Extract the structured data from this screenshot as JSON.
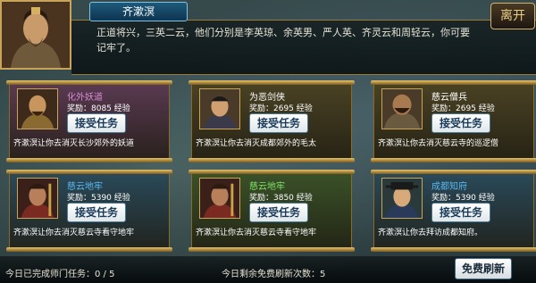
{
  "npc": {
    "name": "齐漱溟",
    "dialog": "正道将兴，三英二云，他们分别是李英琼、余英男、严人英、齐灵云和周轻云，你可要记牢了。",
    "leave_label": "离开"
  },
  "tasks": [
    {
      "title": "化外妖道",
      "title_color": "#d58ad4",
      "reward": "奖励：8085 经验",
      "accept_label": "接受任务",
      "desc": "齐漱溟让你去消灭长沙郊外的妖道",
      "bg_color": "#5a3a52",
      "icon": "bald-monk-portrait"
    },
    {
      "title": "为恶剑侠",
      "title_color": "#ffffff",
      "reward": "奖励：2695 经验",
      "accept_label": "接受任务",
      "desc": "齐漱溟让你去消灭成都郊外的毛太",
      "bg_color": "#4a4224",
      "icon": "swordsman-portrait"
    },
    {
      "title": "慈云僧兵",
      "title_color": "#ffffff",
      "reward": "奖励：2695 经验",
      "accept_label": "接受任务",
      "desc": "齐漱溟让你去消灭慈云寺的巡逻僧",
      "bg_color": "#4a4224",
      "icon": "monk-soldier-portrait"
    },
    {
      "title": "慈云地牢",
      "title_color": "#5ab7f0",
      "reward": "奖励：5390 经验",
      "accept_label": "接受任务",
      "desc": "齐漱溟让你去消灭慈云寺看守地牢",
      "bg_color": "#2a4a5a",
      "icon": "guard-portrait"
    },
    {
      "title": "慈云地牢",
      "title_color": "#7fe06a",
      "reward": "奖励：3850 经验",
      "accept_label": "接受任务",
      "desc": "齐漱溟让你去消灭慈云寺看守地牢",
      "bg_color": "#3a5228",
      "icon": "guard-portrait"
    },
    {
      "title": "成都知府",
      "title_color": "#5ab7f0",
      "reward": "奖励：5390 经验",
      "accept_label": "接受任务",
      "desc": "齐漱溟让你去拜访成都知府。",
      "bg_color": "#2a4a5a",
      "icon": "official-portrait"
    }
  ],
  "footer": {
    "completed": "今日已完成师门任务：0 / 5",
    "free_refresh": "今日剩余免费刷新次数：5",
    "refresh_label": "免费刷新"
  }
}
